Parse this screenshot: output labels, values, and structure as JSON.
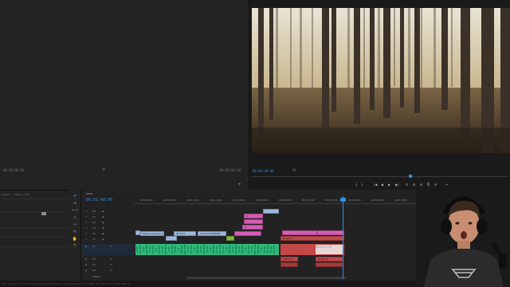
{
  "source": {
    "timecode_left": "00:00:00:00",
    "timecode_right": "00:00:00:00",
    "add_icon": "plus-icon",
    "settings_icon": "wrench-icon"
  },
  "program": {
    "timecode": "00:01:48:00",
    "fit": "Fit",
    "controls": [
      "{",
      "}",
      "|◀",
      "◀",
      "▶",
      "▶|",
      "⊡",
      "⊞",
      "⊟",
      "⎘",
      "⟳",
      "+"
    ]
  },
  "project": {
    "tabs": [
      "Project: ...",
      "Effects",
      "Info"
    ],
    "status": "Click to select, or click in empty space and drag to marquee select. Use Shift, Alt, and Ctrl for other options."
  },
  "timeline": {
    "sequence_name": "2020",
    "timecode": "00:01:48:00",
    "ruler": [
      "00:01:04:00",
      "00:01:08:00",
      "00:01:12:00",
      "00:01:16:00",
      "00:01:20:00",
      "00:01:24:00",
      "00:01:28:00",
      "00:01:32:00",
      "00:01:36:00",
      "00:01:40:00",
      "00:01:44:00",
      "00:01:48:00",
      "00:01:52:00",
      "00:01:56:00",
      "00:02:00:00",
      "00:02:04:00"
    ],
    "tracks": [
      "V6",
      "V5",
      "V4",
      "V3",
      "V2",
      "V1",
      "A1",
      "A2",
      "A3",
      "A4",
      "Master"
    ],
    "clips": {
      "v3_a": "fx",
      "v2_a": "fx",
      "v1_a": "Nested Sequence 01",
      "v1_b": "IFX-0713",
      "v1_c": "IFX-0714 ROUNDER",
      "v1_d": "",
      "v1_e": "Nested 4",
      "v1_f": "Nested 03",
      "v1_g": "Nested 04",
      "v1_h": "Nested 05"
    }
  },
  "colors": {
    "accent": "#2f8ee0",
    "clip_blue": "#9db8dc",
    "clip_pink": "#d65cb4",
    "clip_red": "#c44848",
    "clip_green": "#2fb87a",
    "clip_lime": "#7fbd3a"
  }
}
